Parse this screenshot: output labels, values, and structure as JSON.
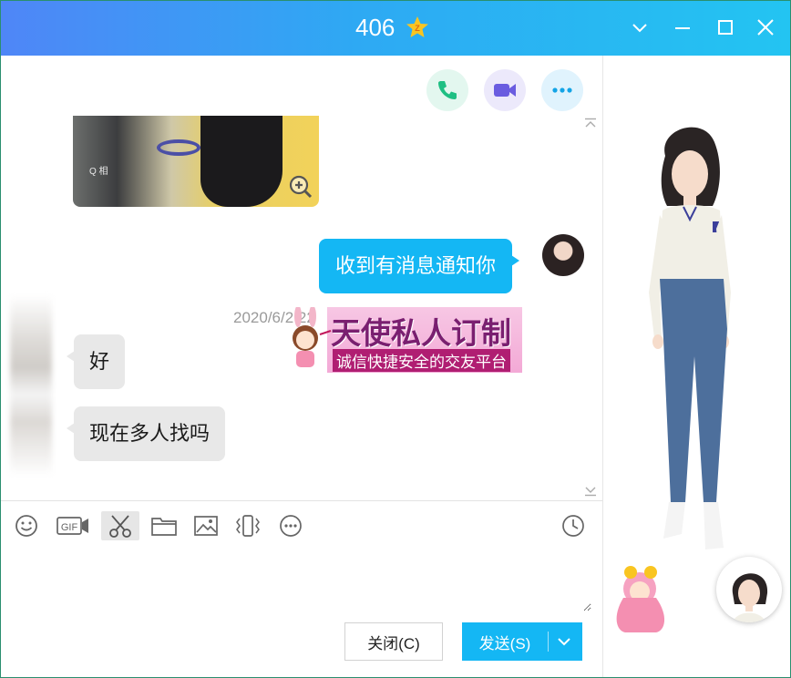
{
  "window": {
    "title": "406",
    "title_badge": "Z",
    "accent": "#14b7f4"
  },
  "chat": {
    "messages": [
      {
        "side": "right",
        "text": "收到有消息通知你"
      },
      {
        "side": "left",
        "text": "好"
      },
      {
        "side": "left",
        "text": "现在多人找吗"
      }
    ],
    "timestamp": "2020/6/2 22",
    "photo_watermark": "Q\n相",
    "ad": {
      "title": "天使私人订制",
      "subtitle": "诚信快捷安全的交友平台"
    }
  },
  "toolbar": {
    "items": [
      "emoji-icon",
      "gif-icon",
      "scissors-icon",
      "folder-icon",
      "image-icon",
      "shake-icon",
      "more-icon",
      "history-icon"
    ],
    "gif_label": "GIF"
  },
  "buttons": {
    "close_label": "关闭(C)",
    "send_label": "发送(S)"
  }
}
